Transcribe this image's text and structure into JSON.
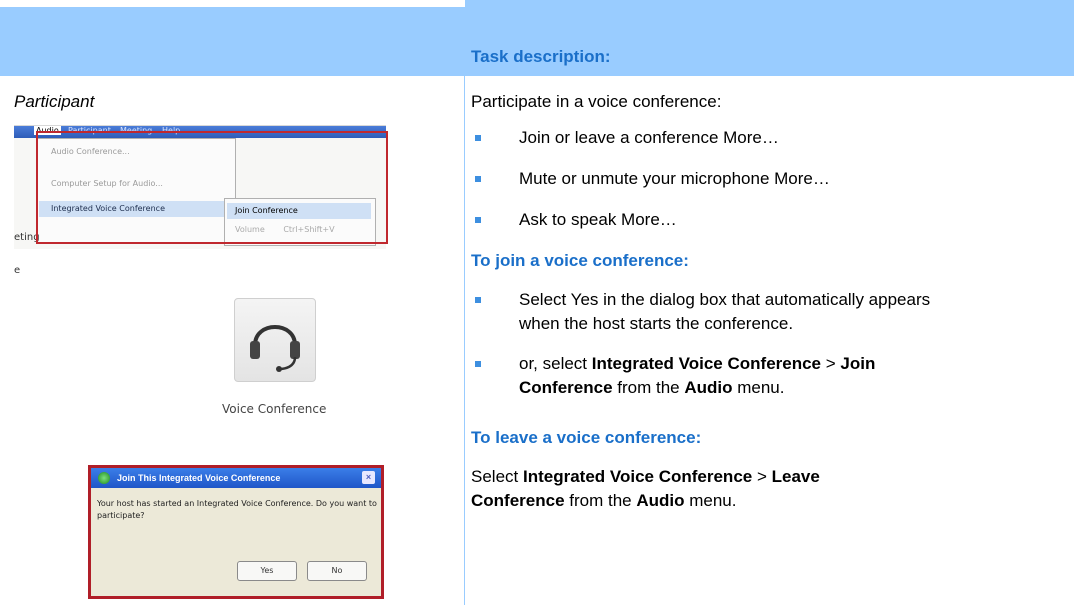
{
  "header": {
    "task_heading": "Task description:"
  },
  "left": {
    "role_label": "Participant",
    "menu_screenshot": {
      "menubar": [
        "Audio",
        "Participant",
        "Meeting",
        "Help"
      ],
      "menu_items": [
        "Audio Conference...",
        "Computer Setup for Audio...",
        "Integrated Voice Conference"
      ],
      "submenu_items": [
        {
          "label": "Join Conference",
          "shortcut": ""
        },
        {
          "label": "Volume",
          "shortcut": "Ctrl+Shift+V"
        }
      ],
      "fragments": [
        "eting",
        "e"
      ]
    },
    "voice_button_label": "Voice Conference",
    "dialog": {
      "title": "Join This Integrated Voice Conference",
      "message": "Your host has started an Integrated Voice Conference. Do you want to participate?",
      "yes_label": "Yes",
      "no_label": "No",
      "close_glyph": "×"
    }
  },
  "right": {
    "intro": "Participate in a voice conference:",
    "tasks": [
      "Join or leave a conference More…",
      "Mute or unmute your microphone More…",
      "Ask to speak More…"
    ],
    "join_heading": "To join a voice conference:",
    "join_step1": "Select Yes in the dialog box that automatically appears when the host starts the conference.",
    "join_step2": {
      "pre": "or, select ",
      "b1": "Integrated Voice Conference",
      "sep": " > ",
      "b2": "Join Conference",
      "mid": " from the ",
      "b3": "Audio",
      "post": " menu."
    },
    "leave_heading": "To leave a voice conference:",
    "leave_text": {
      "pre": "Select ",
      "b1": "Integrated Voice Conference",
      "sep": " > ",
      "b2": "Leave Conference",
      "mid": " from the ",
      "b3": "Audio",
      "post": " menu."
    }
  },
  "colors": {
    "band": "#99ccff",
    "heading": "#1a6fc9",
    "bullet": "#3d8fe0",
    "frame": "#c0282e"
  }
}
